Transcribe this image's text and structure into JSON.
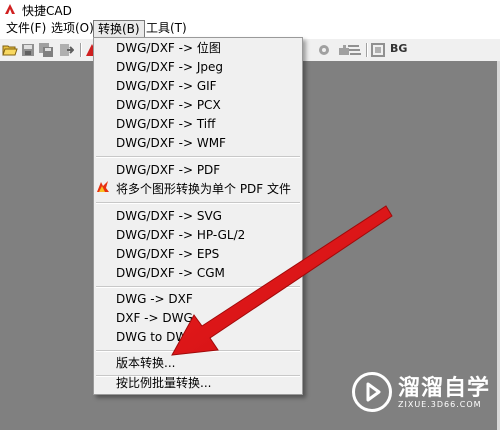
{
  "window": {
    "title": "快捷CAD"
  },
  "menubar": {
    "file": "文件(F)",
    "options": "选项(O)",
    "convert": "转换(B)",
    "tools": "工具(T)"
  },
  "toolbar": {
    "bg_label": "BG"
  },
  "convert_menu": {
    "group1": [
      "DWG/DXF -> 位图",
      "DWG/DXF -> Jpeg",
      "DWG/DXF -> GIF",
      "DWG/DXF -> PCX",
      "DWG/DXF -> Tiff",
      "DWG/DXF -> WMF"
    ],
    "group2": [
      "DWG/DXF -> PDF",
      "将多个图形转换为单个 PDF 文件"
    ],
    "group3": [
      "DWG/DXF -> SVG",
      "DWG/DXF -> HP-GL/2",
      "DWG/DXF -> EPS",
      "DWG/DXF -> CGM"
    ],
    "group4": [
      "DWG -> DXF",
      "DXF -> DWG",
      "DWG to DWF"
    ],
    "version_convert": "版本转换...",
    "scale_batch_convert": "按比例批量转换..."
  },
  "watermark": {
    "brand": "溜溜自学",
    "url": "ZIXUE.3D66.COM"
  },
  "colors": {
    "arrow": "#e8141c",
    "workspace": "#808080",
    "menu_bg": "#f0f0f0"
  }
}
